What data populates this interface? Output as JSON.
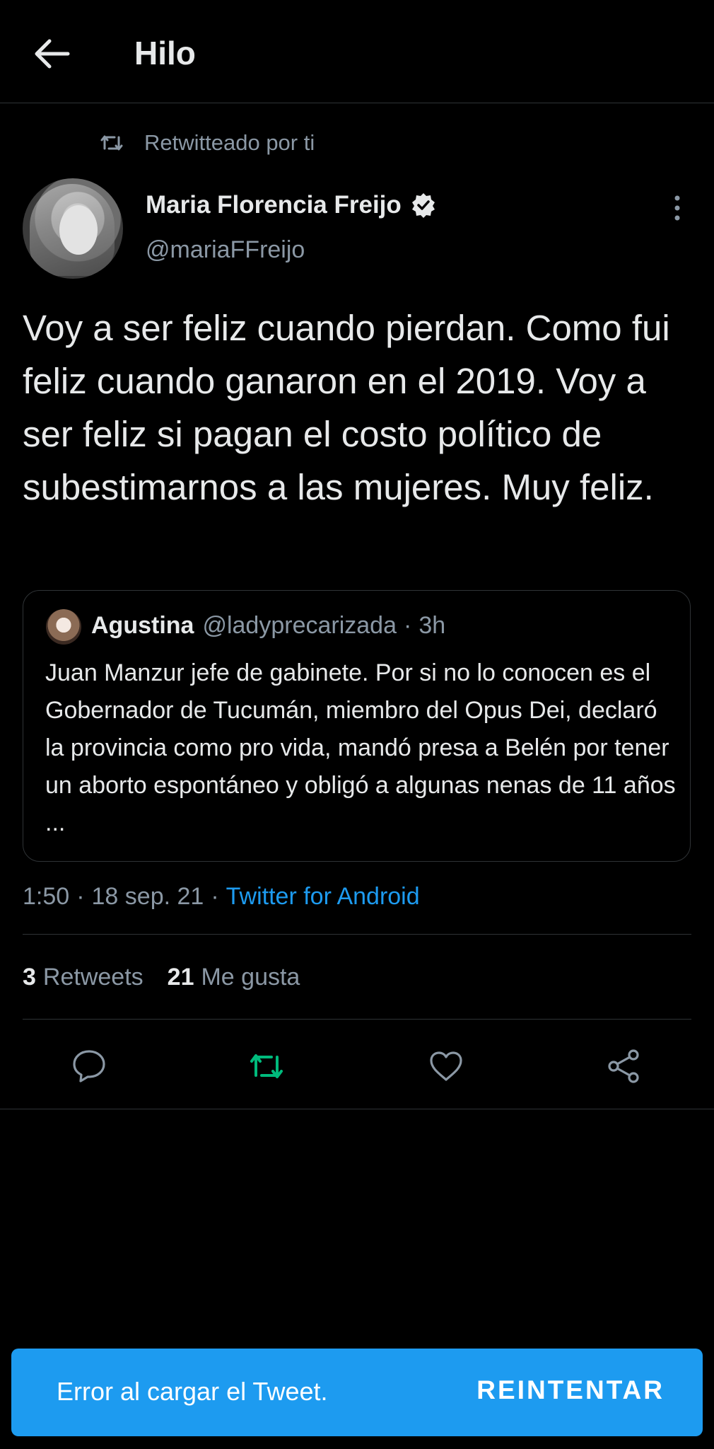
{
  "header": {
    "title": "Hilo",
    "back_icon": "arrow-left-icon"
  },
  "retweet_context": {
    "label": "Retwitteado por ti",
    "icon": "retweet-icon"
  },
  "tweet": {
    "author_name": "Maria Florencia Freijo",
    "author_handle": "@mariaFFreijo",
    "verified": true,
    "text": "Voy a ser feliz cuando pierdan. Como fui feliz cuando ganaron en el 2019. Voy a ser feliz si pagan el costo político de subestimarnos a las mujeres. Muy feliz.",
    "time": "1:50",
    "date": "18 sep. 21",
    "separator": "·",
    "source": "Twitter for Android"
  },
  "quoted_tweet": {
    "author_name": "Agustina",
    "author_handle": "@ladyprecarizada",
    "separator": "·",
    "time": "3h",
    "text": "Juan Manzur jefe de gabinete. Por si no lo conocen es el Gobernador de Tucumán, miembro del Opus Dei, declaró la provincia como pro vida, mandó presa a Belén por tener un aborto espontáneo y obligó a algunas nenas de 11 años ..."
  },
  "stats": {
    "retweets_count": "3",
    "retweets_label": "Retweets",
    "likes_count": "21",
    "likes_label": "Me gusta"
  },
  "actions": [
    "reply-icon",
    "retweet-icon",
    "like-icon",
    "share-icon"
  ],
  "error_bar": {
    "message": "Error al cargar el Tweet.",
    "retry_label": "REINTENTAR"
  },
  "colors": {
    "background": "#000000",
    "text": "#e7e9ea",
    "muted": "#8b98a5",
    "accent": "#1d9bf0",
    "retweet_active": "#00ba7c",
    "divider": "#2f3336"
  }
}
